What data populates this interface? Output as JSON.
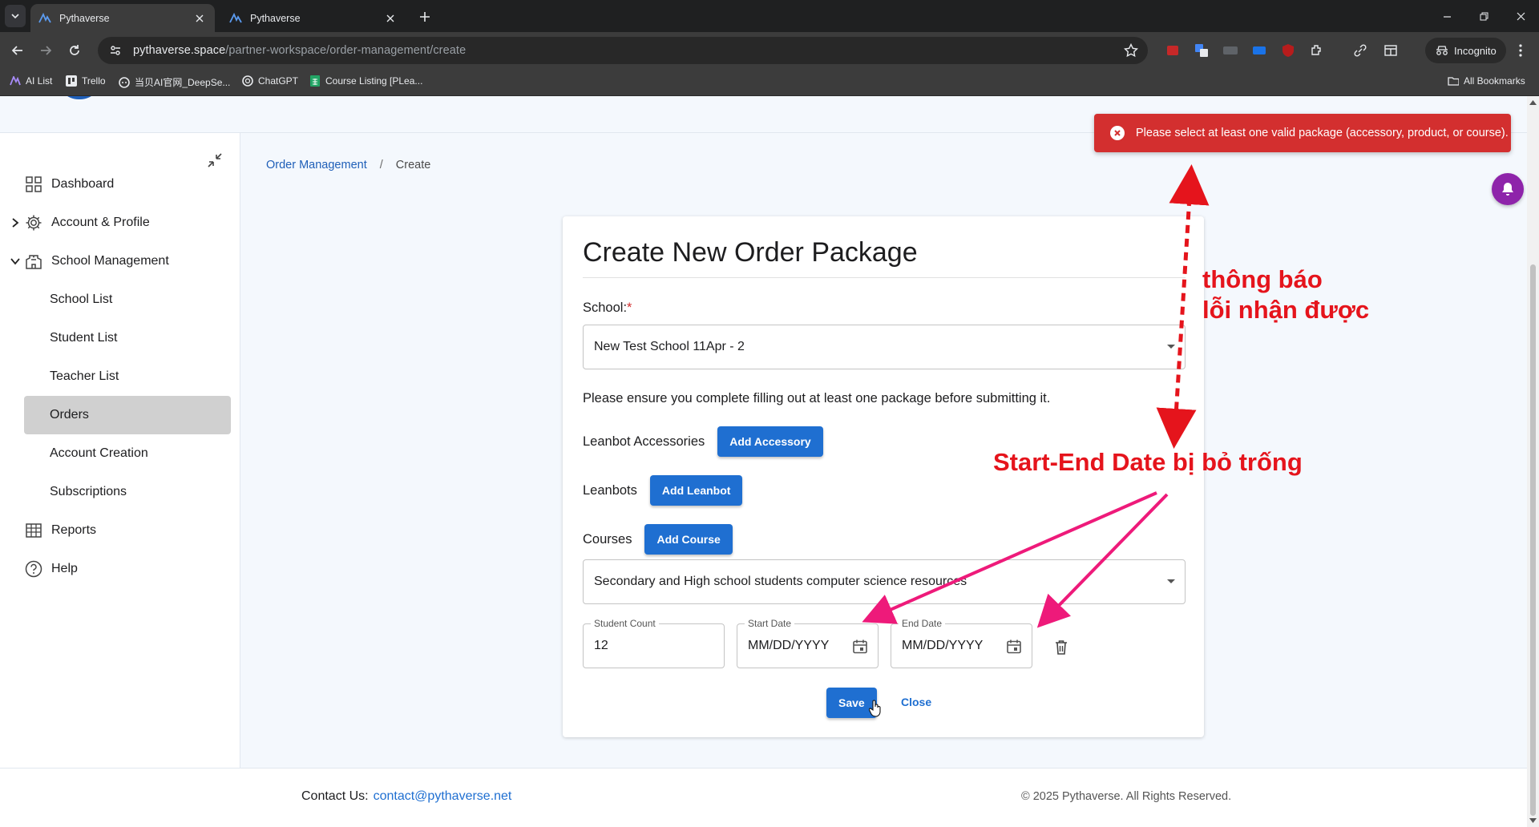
{
  "browser": {
    "tabs": [
      {
        "title": "Pythaverse",
        "active": true
      },
      {
        "title": "Pythaverse",
        "active": false
      }
    ],
    "url_host": "pythaverse.space",
    "url_path": "/partner-workspace/order-management/create",
    "incognito_label": "Incognito",
    "bookmarks": [
      "AI List",
      "Trello",
      "当贝AI官网_DeepSe...",
      "ChatGPT",
      "Course Listing [PLea..."
    ],
    "all_bookmarks_label": "All Bookmarks"
  },
  "sidebar": {
    "items": [
      {
        "label": "Dashboard",
        "icon": "dashboard-icon"
      },
      {
        "label": "Account & Profile",
        "icon": "gear-icon"
      },
      {
        "label": "School Management",
        "icon": "school-icon"
      },
      {
        "label": "School List"
      },
      {
        "label": "Student List"
      },
      {
        "label": "Teacher List"
      },
      {
        "label": "Orders",
        "active": true
      },
      {
        "label": "Account Creation"
      },
      {
        "label": "Subscriptions"
      },
      {
        "label": "Reports",
        "icon": "table-icon"
      },
      {
        "label": "Help",
        "icon": "help-icon"
      }
    ]
  },
  "breadcrumb": {
    "parent": "Order Management",
    "separator": "/",
    "current": "Create"
  },
  "form": {
    "title": "Create New Order Package",
    "school_label": "School:",
    "required_mark": "*",
    "school_value": "New Test School 11Apr - 2",
    "note": "Please ensure you complete filling out at least one package before submitting it.",
    "accessories_label": "Leanbot Accessories",
    "add_accessory": "Add Accessory",
    "leanbots_label": "Leanbots",
    "add_leanbot": "Add Leanbot",
    "courses_label": "Courses",
    "add_course": "Add Course",
    "course_value": "Secondary and High school students computer science resources",
    "student_count_label": "Student Count",
    "student_count_value": "12",
    "start_date_label": "Start Date",
    "start_date_placeholder": "MM/DD/YYYY",
    "end_date_label": "End Date",
    "end_date_placeholder": "MM/DD/YYYY",
    "save": "Save",
    "close": "Close"
  },
  "toast": {
    "message": "Please select at least one valid package (accessory, product, or course).",
    "color": "#d32f2f"
  },
  "footer": {
    "contact_label": "Contact Us:",
    "email": "contact@pythaverse.net",
    "copyright": "© 2025 Pythaverse. All Rights Reserved."
  },
  "annotations": {
    "error_note_line1": "thông báo",
    "error_note_line2": "lỗi nhận được",
    "date_note": "Start-End Date bị bỏ trống"
  },
  "colors": {
    "accent": "#1f6fd1",
    "error": "#d32f2f",
    "annotation_red": "#e5141c",
    "annotation_pink": "#ee1a7a"
  }
}
